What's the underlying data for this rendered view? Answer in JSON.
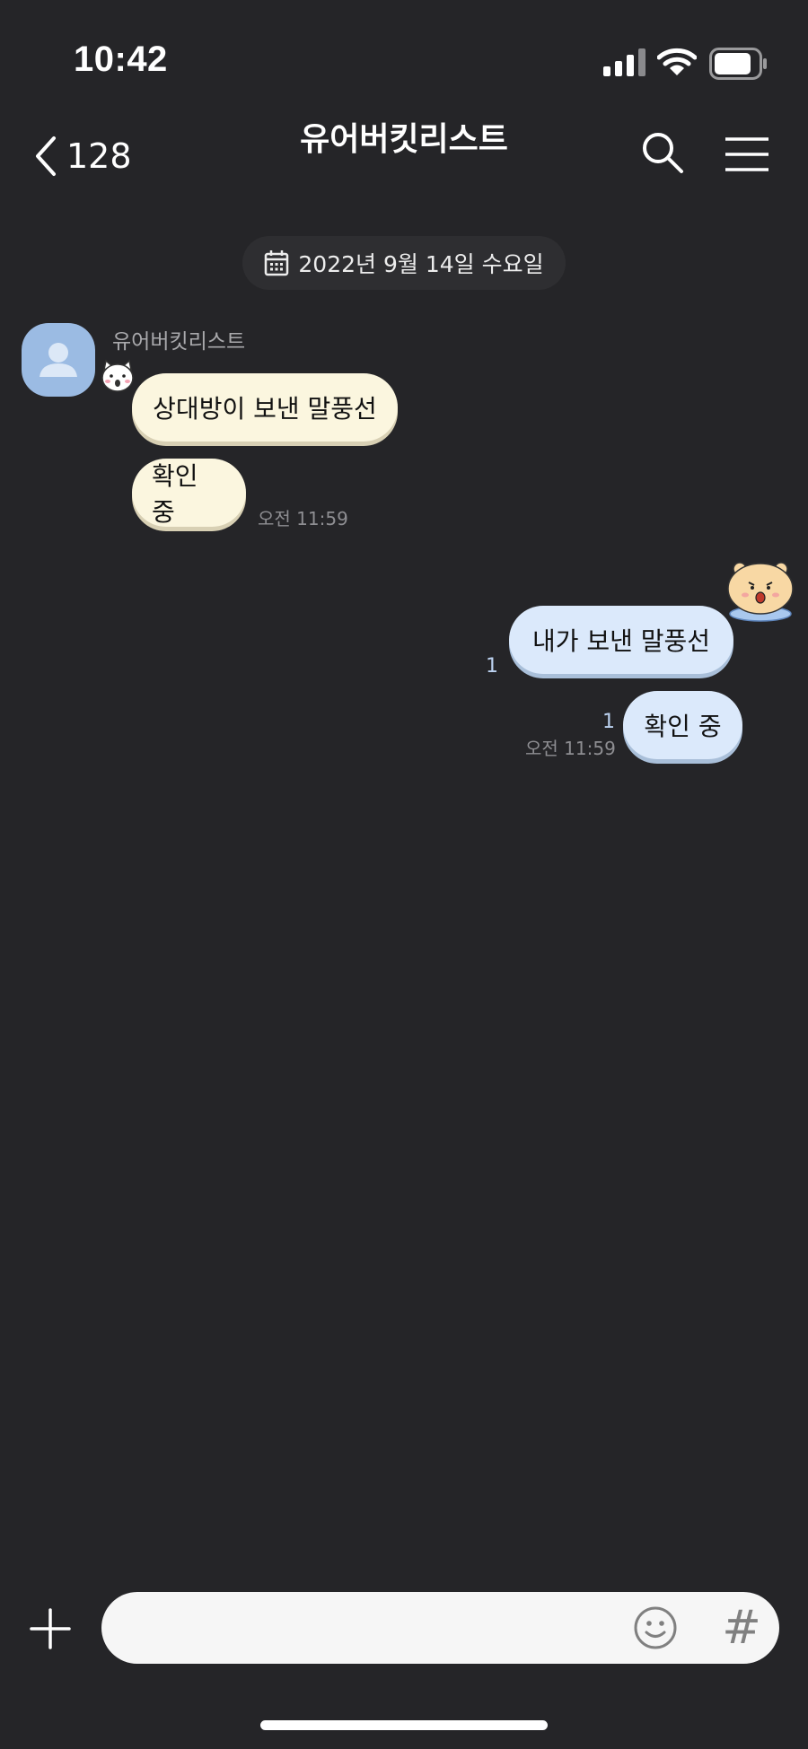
{
  "status_bar": {
    "time": "10:42",
    "icons": [
      "cellular-signal-icon",
      "wifi-icon",
      "battery-icon"
    ]
  },
  "header": {
    "back_count": "128",
    "title": "유어버킷리스트",
    "icons": [
      "chevron-left-icon",
      "search-icon",
      "hamburger-menu-icon"
    ]
  },
  "date_divider": {
    "icon": "calendar-icon",
    "text": "2022년 9월 14일 수요일"
  },
  "received": {
    "sender_name": "유어버킷리스트",
    "avatar_icon": "default-person-icon",
    "sticker": "white-cat-sticker",
    "messages": [
      {
        "text": "상대방이 보낸 말풍선"
      },
      {
        "text": "확인 중",
        "time": "오전 11:59"
      }
    ]
  },
  "sent": {
    "sticker": "yellow-bear-sticker",
    "messages": [
      {
        "text": "내가 보낸 말풍선",
        "unread": "1"
      },
      {
        "text": "확인 중",
        "unread": "1",
        "time": "오전 11:59"
      }
    ]
  },
  "composer": {
    "placeholder": "",
    "value": "",
    "hash_label": "#",
    "icons": [
      "plus-icon",
      "emoji-face-icon",
      "hashtag-icon"
    ]
  },
  "colors": {
    "background": "#252528",
    "received_bubble": "#fbf6df",
    "sent_bubble": "#dbe9fb",
    "read_count": "#bcd2f0"
  }
}
